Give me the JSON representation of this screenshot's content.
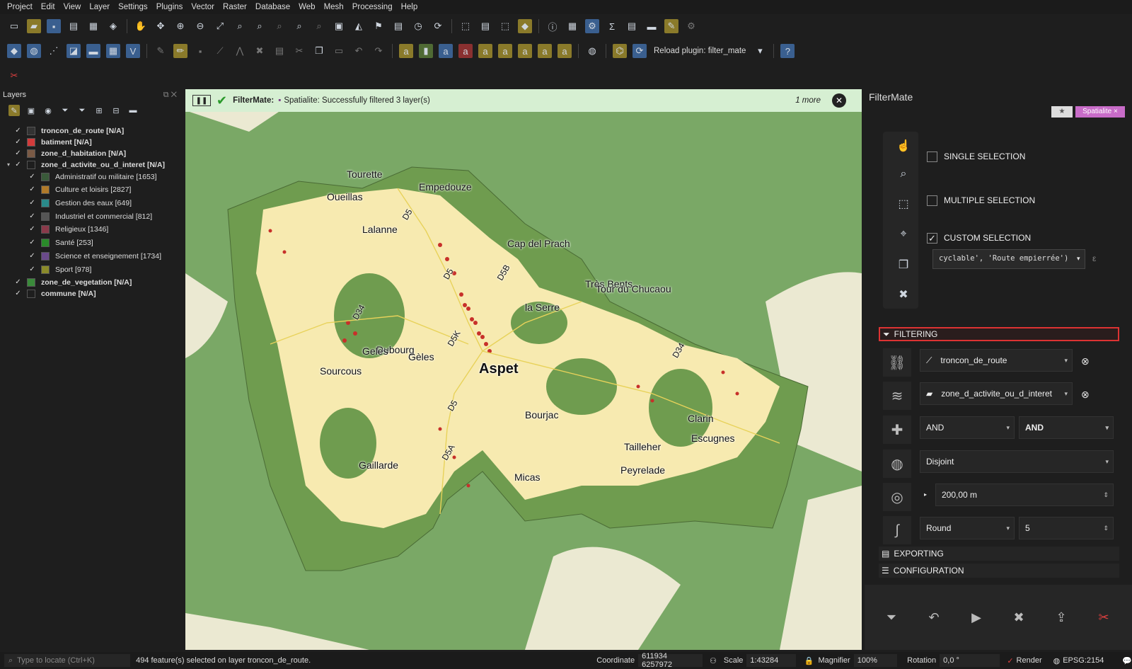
{
  "menu": [
    "Project",
    "Edit",
    "View",
    "Layer",
    "Settings",
    "Plugins",
    "Vector",
    "Raster",
    "Database",
    "Web",
    "Mesh",
    "Processing",
    "Help"
  ],
  "toolbar": {
    "reload_label": "Reload plugin: filter_mate"
  },
  "layers_panel": {
    "title": "Layers",
    "items": [
      {
        "label": "troncon_de_route [N/A]",
        "color": "#333333"
      },
      {
        "label": "batiment [N/A]",
        "color": "#d23b3b"
      },
      {
        "label": "zone_d_habitation [N/A]",
        "color": "#7a5a45"
      },
      {
        "label": "zone_d_activite_ou_d_interet [N/A]",
        "color": ""
      },
      {
        "label": "Administratif ou militaire [1653]",
        "color": "#3a5a3a"
      },
      {
        "label": "Culture et loisirs [2827]",
        "color": "#b07a2a"
      },
      {
        "label": "Gestion des eaux [649]",
        "color": "#2a8a8a"
      },
      {
        "label": "Industriel et commercial [812]",
        "color": "#555555"
      },
      {
        "label": "Religieux [1346]",
        "color": "#8a3a4a"
      },
      {
        "label": "Santé [253]",
        "color": "#2a8a2a"
      },
      {
        "label": "Science et enseignement [1734]",
        "color": "#6a4a8a"
      },
      {
        "label": "Sport [978]",
        "color": "#8a8a2a"
      },
      {
        "label": "zone_de_vegetation [N/A]",
        "color": "#3a8a3a"
      },
      {
        "label": "commune [N/A]",
        "color": ""
      }
    ]
  },
  "message": {
    "app": "FilterMate:",
    "text": "Spatialite: Successfully filtered 3 layer(s)",
    "more": "1 more"
  },
  "map": {
    "places": [
      "Tourette",
      "Empedouze",
      "Oueillas",
      "Lalanne",
      "Cap del Prach",
      "Très Bents",
      "la Serre",
      "Tour du Chucaou",
      "Dubourg",
      "Geles",
      "Gèles",
      "Sourcous",
      "Aspet",
      "Bourjac",
      "Clarin",
      "Escugnes",
      "Tailleher",
      "Peyrelade",
      "Gaillarde",
      "Micas"
    ],
    "roads": [
      "D5",
      "D5",
      "D5B",
      "D34",
      "D5K",
      "D34",
      "D5",
      "D5A"
    ]
  },
  "filtermate": {
    "title": "FilterMate",
    "badge1": "★",
    "badge2": "Spatialite ×",
    "single": "SINGLE SELECTION",
    "multiple": "MULTIPLE SELECTION",
    "custom": "CUSTOM SELECTION",
    "expression": "cyclable', 'Route empierrée')",
    "filtering": "FILTERING",
    "layer1": "troncon_de_route",
    "layer2": "zone_d_activite_ou_d_interet",
    "op1": "AND",
    "op2": "AND",
    "predicate": "Disjoint",
    "buffer": "200,00 m",
    "cap": "Round",
    "segments": "5",
    "exporting": "EXPORTING",
    "configuration": "CONFIGURATION"
  },
  "status": {
    "locate": "Type to locate (Ctrl+K)",
    "message": "494 feature(s) selected on layer troncon_de_route.",
    "coord_label": "Coordinate",
    "coord": "611934  6257972",
    "scale_label": "Scale",
    "scale": "1:43284",
    "magnifier_label": "Magnifier",
    "magnifier": "100%",
    "rotation_label": "Rotation",
    "rotation": "0,0 °",
    "render": "Render",
    "crs": "EPSG:2154"
  }
}
